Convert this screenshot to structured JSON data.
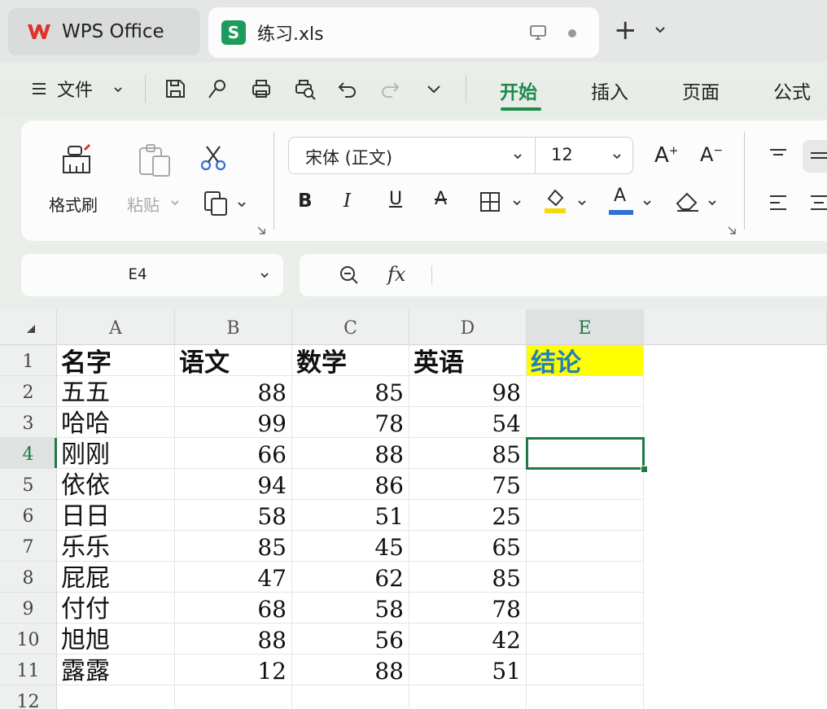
{
  "tabs": {
    "app_label": "WPS Office",
    "file_label": "练习.xls",
    "file_badge": "S",
    "new_tab": "+"
  },
  "menu": {
    "file_label": "文件",
    "ribbon_tabs": [
      "开始",
      "插入",
      "页面",
      "公式"
    ],
    "active_tab": "开始"
  },
  "ribbon": {
    "format_painter": "格式刷",
    "paste": "粘贴",
    "font_name": "宋体 (正文)",
    "font_size": "12",
    "bold": "B",
    "italic": "I",
    "underline": "U",
    "strike": "A",
    "grow_font": "A",
    "shrink_font": "A",
    "font_color_letter": "A",
    "highlight_color": "#f5d90a",
    "font_color": "#2f6fd6"
  },
  "formula_bar": {
    "name_box": "E4",
    "fx_label": "fx",
    "formula": ""
  },
  "sheet": {
    "columns": [
      "A",
      "B",
      "C",
      "D",
      "E"
    ],
    "selected_column": "E",
    "row_numbers": [
      "1",
      "2",
      "3",
      "4",
      "5",
      "6",
      "7",
      "8",
      "9",
      "10",
      "11",
      "12"
    ],
    "selected_row": "4",
    "header": [
      "名字",
      "语文",
      "数学",
      "英语",
      "结论"
    ],
    "rows": [
      [
        "五五",
        "88",
        "85",
        "98"
      ],
      [
        "哈哈",
        "99",
        "78",
        "54"
      ],
      [
        "刚刚",
        "66",
        "88",
        "85"
      ],
      [
        "依依",
        "94",
        "86",
        "75"
      ],
      [
        "日日",
        "58",
        "51",
        "25"
      ],
      [
        "乐乐",
        "85",
        "45",
        "65"
      ],
      [
        "屁屁",
        "47",
        "62",
        "85"
      ],
      [
        "付付",
        "68",
        "58",
        "78"
      ],
      [
        "旭旭",
        "88",
        "56",
        "42"
      ],
      [
        "露露",
        "12",
        "88",
        "51"
      ]
    ],
    "selected_cell": "E4",
    "accent_color": "#1f7a43",
    "header_fill": "#ffff00"
  }
}
